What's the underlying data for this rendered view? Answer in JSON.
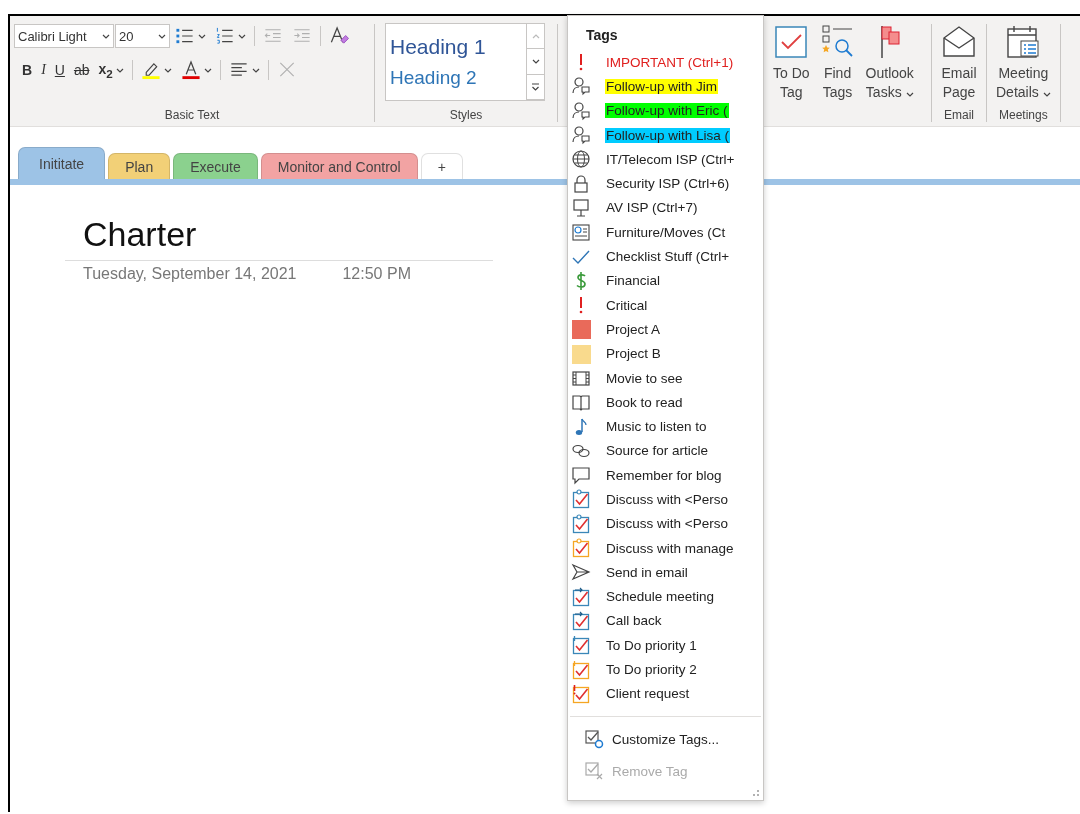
{
  "ribbon": {
    "basic_text": {
      "font": "Calibri Light",
      "size": "20",
      "row1": [
        {
          "kind": "bullets",
          "dropdown": true,
          "disabled": false
        },
        {
          "kind": "numbering",
          "dropdown": true,
          "disabled": false
        },
        {
          "kind": "outdent",
          "dropdown": false,
          "disabled": true
        },
        {
          "kind": "indent",
          "dropdown": false,
          "disabled": true
        },
        {
          "kind": "clear-format",
          "dropdown": false,
          "disabled": false
        }
      ],
      "row2": [
        {
          "kind": "text",
          "label": "B",
          "dropdown": false,
          "disabled": false
        },
        {
          "kind": "text",
          "label": "I",
          "dropdown": false,
          "disabled": false
        },
        {
          "kind": "text",
          "label": "U",
          "dropdown": false,
          "disabled": false
        },
        {
          "kind": "text",
          "label": "ab",
          "dropdown": false,
          "disabled": false
        },
        {
          "kind": "text",
          "label": "x$_{2}$",
          "dropdown": true,
          "disabled": false
        },
        {
          "kind": "highlighter",
          "dropdown": true,
          "disabled": false
        },
        {
          "kind": "font-color",
          "dropdown": true,
          "disabled": false
        },
        {
          "kind": "align",
          "dropdown": true,
          "disabled": false
        },
        {
          "kind": "delete",
          "dropdown": false,
          "disabled": true
        }
      ],
      "label": "Basic Text"
    },
    "styles": {
      "items": [
        "Heading 1",
        "Heading 2"
      ],
      "label": "Styles"
    },
    "tags_buttons": [
      {
        "kind": "todo",
        "label": "To Do\nTag",
        "dropdown": false
      },
      {
        "kind": "find",
        "label": "Find\nTags",
        "dropdown": false
      },
      {
        "kind": "flag",
        "label": "Outlook\nTasks",
        "dropdown": true
      }
    ],
    "groups": [
      {
        "kind": "email",
        "buttons": [
          {
            "label": "Email\nPage",
            "dropdown": false
          }
        ],
        "label": "Email"
      },
      {
        "kind": "meeting",
        "buttons": [
          {
            "label": "Meeting\nDetails",
            "dropdown": true
          }
        ],
        "label": "Meetings"
      }
    ]
  },
  "section_tabs": [
    {
      "label": "Inititate",
      "color": "#9dc3e6",
      "selected": true
    },
    {
      "label": "Plan",
      "color": "#f2d077",
      "selected": false
    },
    {
      "label": "Execute",
      "color": "#8bd18e",
      "selected": false
    },
    {
      "label": "Monitor and Control",
      "color": "#f2a3a3",
      "selected": false
    },
    {
      "label": "+",
      "color": "#ffffff",
      "selected": false
    }
  ],
  "page": {
    "title": "Charter",
    "date": "Tuesday, September 14, 2021",
    "time": "12:50 PM"
  },
  "tags_menu": {
    "title": "Tags",
    "items": [
      {
        "label": "IMPORTANT (Ctrl+1)",
        "kind": "important"
      },
      {
        "label": "Follow-up with Jim",
        "kind": "person",
        "color": "#ffff00"
      },
      {
        "label": "Follow-up with Eric (",
        "kind": "person",
        "color": "#00ff00"
      },
      {
        "label": "Follow-up with Lisa (",
        "kind": "person",
        "color": "#00ccff"
      },
      {
        "label": "IT/Telecom ISP (Ctrl+",
        "kind": "globe"
      },
      {
        "label": "Security ISP (Ctrl+6)",
        "kind": "lock"
      },
      {
        "label": "AV ISP (Ctrl+7)",
        "kind": "screen"
      },
      {
        "label": "Furniture/Moves (Ct",
        "kind": "planner"
      },
      {
        "label": "Checklist Stuff (Ctrl+",
        "kind": "check"
      },
      {
        "label": "Financial",
        "kind": "dollar"
      },
      {
        "label": "Critical",
        "kind": "critical"
      },
      {
        "label": "Project A",
        "kind": "square",
        "color": "#e96a5a"
      },
      {
        "label": "Project B",
        "kind": "square",
        "color": "#f9da8d"
      },
      {
        "label": "Movie to see",
        "kind": "film"
      },
      {
        "label": "Book to read",
        "kind": "book"
      },
      {
        "label": "Music to listen to",
        "kind": "note"
      },
      {
        "label": "Source for article",
        "kind": "link"
      },
      {
        "label": "Remember for blog",
        "kind": "speech"
      },
      {
        "label": "Discuss with <Perso",
        "kind": "todo-person",
        "color": "#3a87b8"
      },
      {
        "label": "Discuss with <Perso",
        "kind": "todo-person",
        "color": "#3a87b8"
      },
      {
        "label": "Discuss with manage",
        "kind": "todo-person",
        "color": "#f5a623"
      },
      {
        "label": "Send in email",
        "kind": "send"
      },
      {
        "label": "Schedule meeting",
        "kind": "todo-arrow",
        "color": "#3a87b8"
      },
      {
        "label": "Call back",
        "kind": "todo-arrow",
        "color": "#3a87b8"
      },
      {
        "label": "To Do priority 1",
        "kind": "todo-mark",
        "color": "#3a87b8"
      },
      {
        "label": "To Do priority 2",
        "kind": "todo-mark",
        "color": "#f5a623"
      },
      {
        "label": "Client request",
        "kind": "todo-alert",
        "color": "#f5a623"
      }
    ],
    "actions": [
      {
        "label": "Customize Tags...",
        "kind": "customize",
        "disabled": false
      },
      {
        "label": "Remove Tag",
        "kind": "remove",
        "disabled": true
      }
    ]
  }
}
